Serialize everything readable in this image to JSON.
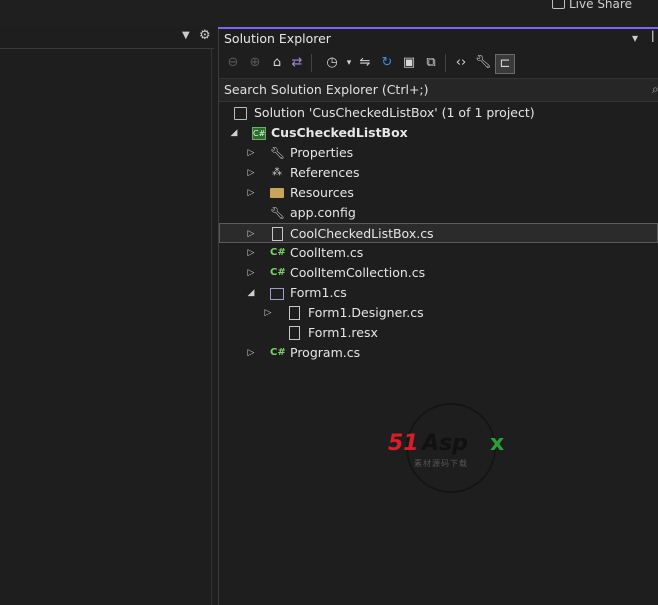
{
  "top": {
    "live_share": "Live Share"
  },
  "solution_explorer": {
    "title": "Solution Explorer",
    "search_placeholder": "Search Solution Explorer (Ctrl+;)"
  },
  "tree": {
    "solution": "Solution 'CusCheckedListBox' (1 of 1 project)",
    "project": "CusCheckedListBox",
    "items": {
      "properties": "Properties",
      "references": "References",
      "resources": "Resources",
      "app_config": "app.config",
      "coolchecked": "CoolCheckedListBox.cs",
      "coolitem": "CoolItem.cs",
      "coolitemcollection": "CoolItemCollection.cs",
      "form1": "Form1.cs",
      "form1_designer": "Form1.Designer.cs",
      "form1_resx": "Form1.resx",
      "program": "Program.cs"
    }
  },
  "watermark": {
    "brand_a": "51",
    "brand_b": "Asp",
    "brand_c": "x",
    "sub": "素材源码下载"
  },
  "icons": [
    "back-icon",
    "forward-icon",
    "home-icon",
    "vs-switch-icon",
    "history-icon",
    "sync-icon",
    "refresh-icon",
    "collapse-icon",
    "copy-icon",
    "code-icon",
    "properties-wrench-icon",
    "preview-icon"
  ],
  "colors": {
    "accent": "#7b68ee",
    "background": "#1e1e1e",
    "csharp": "#7bd36b"
  }
}
